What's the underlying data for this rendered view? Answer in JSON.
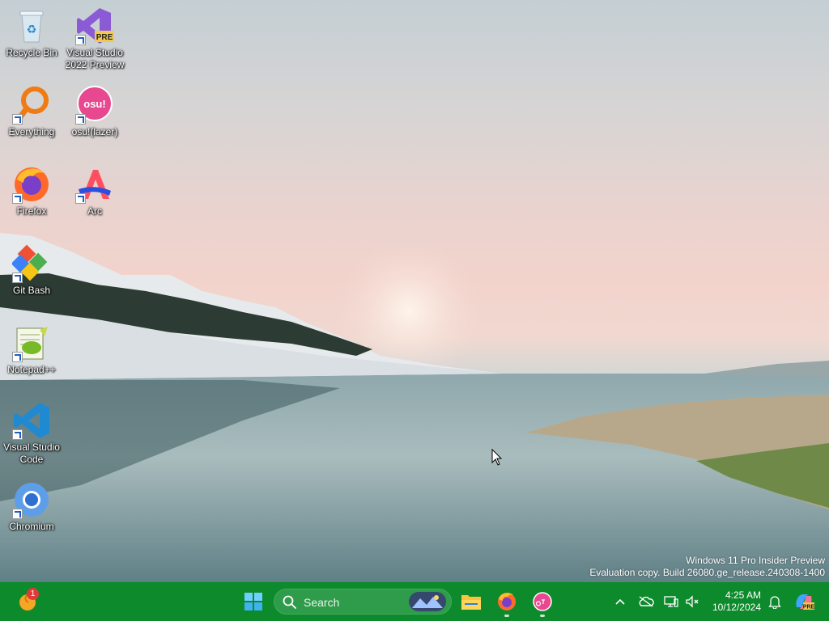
{
  "desktop": {
    "icons": [
      {
        "label": "Recycle Bin",
        "icon": "recycle-bin-icon",
        "shortcut": false
      },
      {
        "label": "Visual Studio 2022 Preview",
        "icon": "visual-studio-preview-icon",
        "shortcut": true,
        "badge": "PRE"
      },
      {
        "label": "Everything",
        "icon": "everything-search-icon",
        "shortcut": true
      },
      {
        "label": "osu!(lazer)",
        "icon": "osu-icon",
        "shortcut": true,
        "badge": "osu!"
      },
      {
        "label": "Firefox",
        "icon": "firefox-icon",
        "shortcut": true
      },
      {
        "label": "Arc",
        "icon": "arc-icon",
        "shortcut": true
      },
      {
        "label": "Git Bash",
        "icon": "git-bash-icon",
        "shortcut": true
      },
      {
        "label": "Notepad++",
        "icon": "notepadpp-icon",
        "shortcut": true
      },
      {
        "label": "Visual Studio Code",
        "icon": "vscode-icon",
        "shortcut": true
      },
      {
        "label": "Chromium",
        "icon": "chromium-icon",
        "shortcut": true
      }
    ]
  },
  "watermark": {
    "line1": "Windows 11 Pro Insider Preview",
    "line2": "Evaluation copy. Build 26080.ge_release.240308-1400"
  },
  "taskbar": {
    "widgets_badge": "1",
    "search_placeholder": "Search",
    "pinned": [
      "start-icon",
      "search-icon",
      "file-explorer-icon",
      "firefox-icon",
      "osu-icon"
    ],
    "clock": {
      "time": "4:25 AM",
      "date": "10/12/2024"
    },
    "tray": [
      "chevron-up-icon",
      "onedrive-offline-icon",
      "network-icon",
      "volume-muted-icon",
      "notification-bell-icon",
      "copilot-icon"
    ]
  },
  "colors": {
    "taskbar": "#0d8a2c",
    "search_box": "#2e9c4a"
  }
}
